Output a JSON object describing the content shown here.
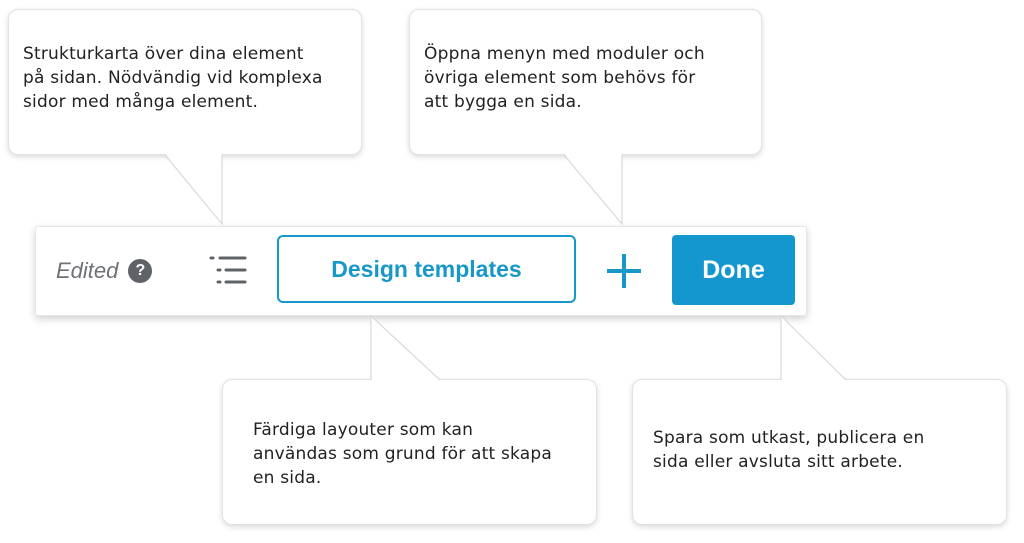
{
  "callouts": {
    "structure_map": "Strukturkarta över dina element\npå sidan. Nödvändig vid komplexa\nsidor med många element.",
    "modules_menu": "Öppna menyn med moduler och\növriga element som behövs för\natt bygga en sida.",
    "design_templates": "Färdiga layouter som kan\nanvändas som grund för att skapa\nen sida.",
    "done": "Spara som utkast, publicera en\nsida eller avsluta sitt arbete."
  },
  "toolbar": {
    "status_label": "Edited",
    "help_glyph": "?",
    "design_templates_label": "Design templates",
    "done_label": "Done"
  },
  "colors": {
    "accent": "#1897c9",
    "done_bg": "#1497cf",
    "muted_text": "#6e7175"
  },
  "icons": [
    "help-icon",
    "list-icon",
    "plus-icon"
  ]
}
